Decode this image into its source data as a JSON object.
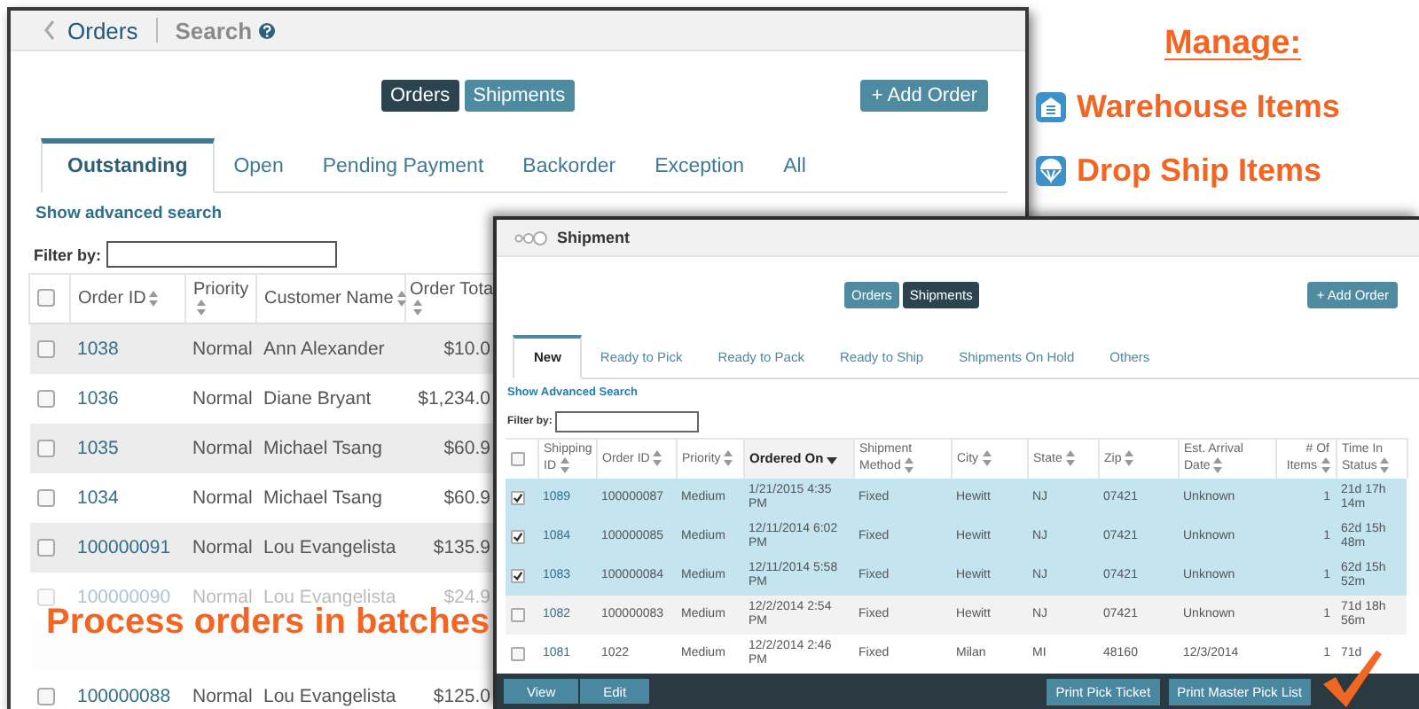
{
  "orders_window": {
    "back_label": "Orders",
    "title": "Search",
    "toggle": [
      {
        "label": "Orders",
        "selected": true
      },
      {
        "label": "Shipments",
        "selected": false
      }
    ],
    "add_button": "+ Add Order",
    "tabs": [
      {
        "label": "Outstanding",
        "selected": true
      },
      {
        "label": "Open",
        "selected": false
      },
      {
        "label": "Pending Payment",
        "selected": false
      },
      {
        "label": "Backorder",
        "selected": false
      },
      {
        "label": "Exception",
        "selected": false
      },
      {
        "label": "All",
        "selected": false
      }
    ],
    "advanced_link": "Show advanced search",
    "filter_label": "Filter by:",
    "select_all_checked": false,
    "columns": [
      "Order ID",
      "Priority",
      "Customer Name",
      "Order Tota"
    ],
    "rows": [
      {
        "checked": false,
        "dimmed": false,
        "cells": [
          "1038",
          "Normal",
          "Ann Alexander",
          "$10.0"
        ]
      },
      {
        "checked": false,
        "dimmed": false,
        "cells": [
          "1036",
          "Normal",
          "Diane Bryant",
          "$1,234.0"
        ]
      },
      {
        "checked": false,
        "dimmed": false,
        "cells": [
          "1035",
          "Normal",
          "Michael Tsang",
          "$60.9"
        ]
      },
      {
        "checked": false,
        "dimmed": false,
        "cells": [
          "1034",
          "Normal",
          "Michael Tsang",
          "$60.9"
        ]
      },
      {
        "checked": false,
        "dimmed": false,
        "cells": [
          "100000091",
          "Normal",
          "Lou Evangelista",
          "$135.9"
        ]
      },
      {
        "checked": false,
        "dimmed": true,
        "cells": [
          "100000090",
          "Normal",
          "Lou Evangelista",
          "$24.9"
        ]
      },
      {
        "dimmed": true
      },
      {
        "checked": false,
        "dimmed": false,
        "cells": [
          "100000088",
          "Normal",
          "Lou Evangelista",
          "$125.0"
        ]
      }
    ]
  },
  "shipment_window": {
    "title": "Shipment",
    "toggle": [
      {
        "label": "Orders",
        "selected": false
      },
      {
        "label": "Shipments",
        "selected": true
      }
    ],
    "add_button": "+ Add Order",
    "tabs": [
      {
        "label": "New",
        "selected": true
      },
      {
        "label": "Ready to Pick",
        "selected": false
      },
      {
        "label": "Ready to Pack",
        "selected": false
      },
      {
        "label": "Ready to Ship",
        "selected": false
      },
      {
        "label": "Shipments On Hold",
        "selected": false
      },
      {
        "label": "Others",
        "selected": false
      }
    ],
    "advanced_link": "Show Advanced Search",
    "filter_label": "Filter by:",
    "select_all_checked": false,
    "columns": [
      {
        "label": "Shipping ID",
        "sorted": false
      },
      {
        "label": "Order ID",
        "sorted": false
      },
      {
        "label": "Priority",
        "sorted": false
      },
      {
        "label": "Ordered On",
        "sorted": true
      },
      {
        "label": "Shipment Method",
        "sorted": false
      },
      {
        "label": "City",
        "sorted": false
      },
      {
        "label": "State",
        "sorted": false
      },
      {
        "label": "Zip",
        "sorted": false
      },
      {
        "label": "Est. Arrival Date",
        "sorted": false
      },
      {
        "label": "# Of Items",
        "sorted": false
      },
      {
        "label": "Time In Status",
        "sorted": false
      }
    ],
    "rows": [
      {
        "selected": true,
        "cells": [
          "1089",
          "100000087",
          "Medium",
          "1/21/2015 4:35 PM",
          "Fixed",
          "Hewitt",
          "NJ",
          "07421",
          "Unknown",
          "1",
          "21d 17h 14m"
        ]
      },
      {
        "selected": true,
        "cells": [
          "1084",
          "100000085",
          "Medium",
          "12/11/2014 6:02 PM",
          "Fixed",
          "Hewitt",
          "NJ",
          "07421",
          "Unknown",
          "1",
          "62d 15h 48m"
        ]
      },
      {
        "selected": true,
        "cells": [
          "1083",
          "100000084",
          "Medium",
          "12/11/2014 5:58 PM",
          "Fixed",
          "Hewitt",
          "NJ",
          "07421",
          "Unknown",
          "1",
          "62d 15h 52m"
        ]
      },
      {
        "selected": false,
        "cells": [
          "1082",
          "100000083",
          "Medium",
          "12/2/2014 2:54 PM",
          "Fixed",
          "Hewitt",
          "NJ",
          "07421",
          "Unknown",
          "1",
          "71d 18h 56m"
        ]
      },
      {
        "selected": false,
        "cells": [
          "1081",
          "1022",
          "Medium",
          "12/2/2014 2:46 PM",
          "Fixed",
          "Milan",
          "MI",
          "48160",
          "12/3/2014",
          "1",
          "71d"
        ]
      }
    ],
    "left_buttons": [
      "View",
      "Edit"
    ],
    "right_buttons": [
      "Print Pick Ticket",
      "Print Master Pick List"
    ]
  },
  "promo": {
    "heading": "Manage:",
    "items": [
      {
        "kind": "warehouse",
        "label": "Warehouse Items"
      },
      {
        "kind": "dropship",
        "label": "Drop Ship Items"
      }
    ],
    "caption": "Process orders in batches"
  }
}
